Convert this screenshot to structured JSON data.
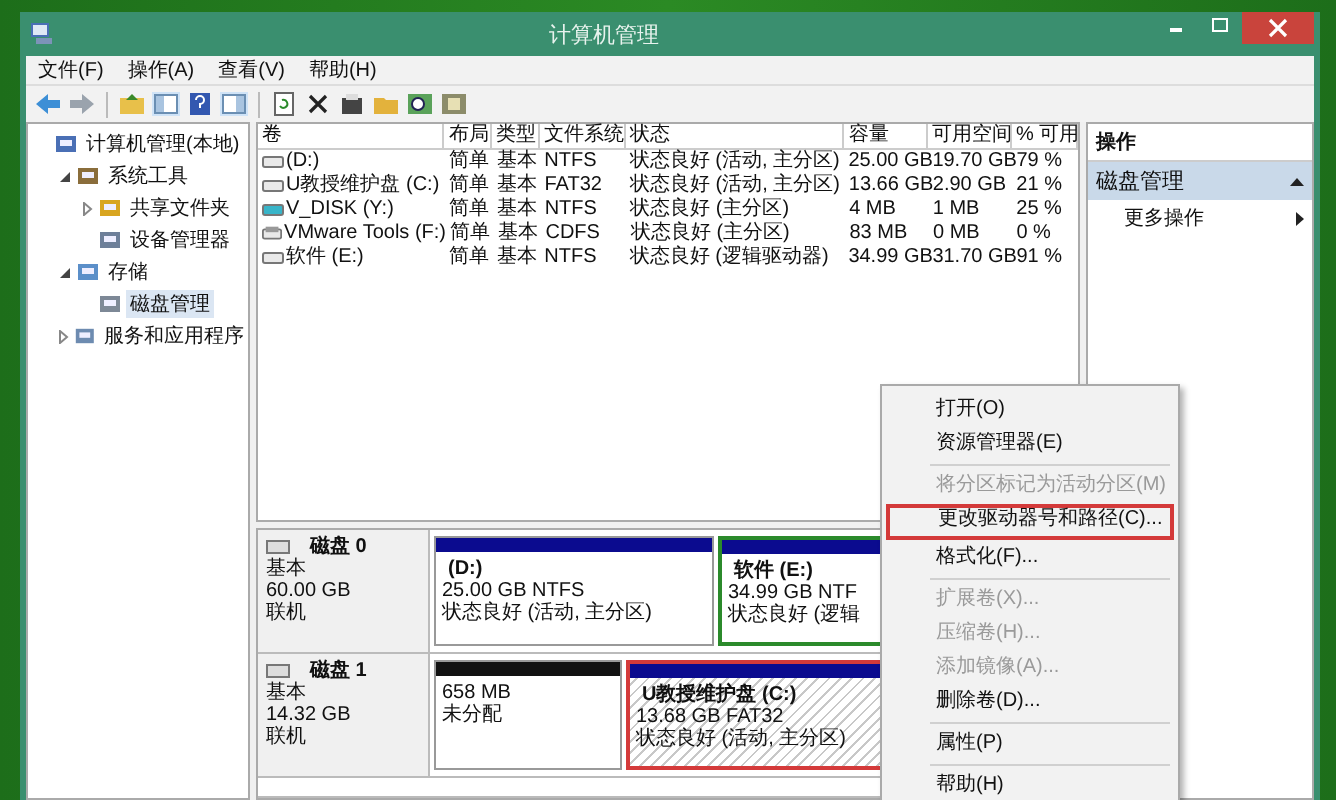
{
  "window": {
    "title": "计算机管理"
  },
  "menu": [
    "文件(F)",
    "操作(A)",
    "查看(V)",
    "帮助(H)"
  ],
  "tree": [
    {
      "label": "计算机管理(本地)",
      "selected": false,
      "children": [
        {
          "label": "系统工具",
          "expanded": true,
          "selected": false,
          "children": [
            {
              "label": "共享文件夹",
              "expanded": false,
              "selected": false
            },
            {
              "label": "设备管理器",
              "selected": false
            }
          ]
        },
        {
          "label": "存储",
          "expanded": true,
          "selected": false,
          "children": [
            {
              "label": "磁盘管理",
              "selected": true
            }
          ]
        },
        {
          "label": "服务和应用程序",
          "expanded": false,
          "selected": false
        }
      ]
    }
  ],
  "table": {
    "columns": [
      "卷",
      "布局",
      "类型",
      "文件系统",
      "状态",
      "容量",
      "可用空间",
      "% 可用"
    ],
    "rows": [
      {
        "cells": [
          "(D:)",
          "简单",
          "基本",
          "NTFS",
          "状态良好 (活动, 主分区)",
          "25.00 GB",
          "19.70 GB",
          "79 %"
        ]
      },
      {
        "cells": [
          "U教授维护盘 (C:)",
          "简单",
          "基本",
          "FAT32",
          "状态良好 (活动, 主分区)",
          "13.66 GB",
          "2.90 GB",
          "21 %"
        ]
      },
      {
        "cells": [
          "V_DISK (Y:)",
          "简单",
          "基本",
          "NTFS",
          "状态良好 (主分区)",
          "4 MB",
          "1 MB",
          "25 %"
        ]
      },
      {
        "cells": [
          "VMware Tools (F:)",
          "简单",
          "基本",
          "CDFS",
          "状态良好 (主分区)",
          "83 MB",
          "0 MB",
          "0 %"
        ]
      },
      {
        "cells": [
          "软件 (E:)",
          "简单",
          "基本",
          "NTFS",
          "状态良好 (逻辑驱动器)",
          "34.99 GB",
          "31.70 GB",
          "91 %"
        ]
      }
    ]
  },
  "disks": [
    {
      "name": "磁盘 0",
      "type": "基本",
      "size": "60.00 GB",
      "status": "联机",
      "partitions": [
        {
          "kind": "primary",
          "label": "(D:)",
          "size": "25.00 GB NTFS",
          "status": "状态良好 (活动, 主分区)",
          "selected": false
        },
        {
          "kind": "logical",
          "label": "软件   (E:)",
          "size": "34.99 GB NTF",
          "status": "状态良好 (逻辑",
          "selected": false
        }
      ]
    },
    {
      "name": "磁盘 1",
      "type": "基本",
      "size": "14.32 GB",
      "status": "联机",
      "partitions": [
        {
          "kind": "unallocated",
          "size": "658 MB",
          "status": "未分配",
          "selected": false
        },
        {
          "kind": "primary",
          "label": "U教授维护盘   (C:)",
          "size": "13.68 GB FAT32",
          "status": "状态良好 (活动, 主分区)",
          "selected": true
        }
      ]
    }
  ],
  "actions": {
    "title": "操作",
    "section": "磁盘管理",
    "items": [
      "更多操作"
    ]
  },
  "context_menu": [
    {
      "kind": "item",
      "label": "打开(O)",
      "disabled": false,
      "highlighted": false
    },
    {
      "kind": "item",
      "label": "资源管理器(E)",
      "disabled": false,
      "highlighted": false
    },
    {
      "kind": "separator"
    },
    {
      "kind": "item",
      "label": "将分区标记为活动分区(M)",
      "disabled": true,
      "highlighted": false
    },
    {
      "kind": "item",
      "label": "更改驱动器号和路径(C)...",
      "disabled": false,
      "highlighted": true
    },
    {
      "kind": "item",
      "label": "格式化(F)...",
      "disabled": false,
      "highlighted": false
    },
    {
      "kind": "separator"
    },
    {
      "kind": "item",
      "label": "扩展卷(X)...",
      "disabled": true,
      "highlighted": false
    },
    {
      "kind": "item",
      "label": "压缩卷(H)...",
      "disabled": true,
      "highlighted": false
    },
    {
      "kind": "item",
      "label": "添加镜像(A)...",
      "disabled": true,
      "highlighted": false
    },
    {
      "kind": "item",
      "label": "删除卷(D)...",
      "disabled": false,
      "highlighted": false
    },
    {
      "kind": "separator"
    },
    {
      "kind": "item",
      "label": "属性(P)",
      "disabled": false,
      "highlighted": false
    },
    {
      "kind": "separator"
    },
    {
      "kind": "item",
      "label": "帮助(H)",
      "disabled": false,
      "highlighted": false
    }
  ]
}
